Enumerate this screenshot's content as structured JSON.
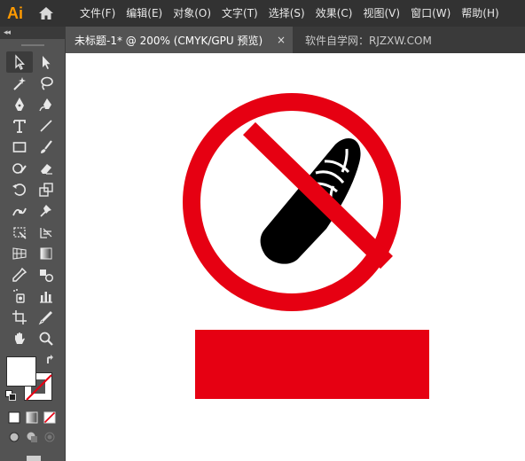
{
  "app": {
    "logo_text": "Ai"
  },
  "menu": {
    "items": [
      {
        "label": "文件(F)"
      },
      {
        "label": "编辑(E)"
      },
      {
        "label": "对象(O)"
      },
      {
        "label": "文字(T)"
      },
      {
        "label": "选择(S)"
      },
      {
        "label": "效果(C)"
      },
      {
        "label": "视图(V)"
      },
      {
        "label": "窗口(W)"
      },
      {
        "label": "帮助(H)"
      }
    ]
  },
  "tabs": [
    {
      "label": "未标题-1* @ 200% (CMYK/GPU 预览)",
      "close": "×",
      "active": true
    },
    {
      "label": "软件自学网：RJZXW.COM",
      "active": false
    }
  ],
  "toolbar": {
    "collapse_label": "◂◂",
    "tools": [
      [
        "selection-tool",
        "direct-selection-tool"
      ],
      [
        "magic-wand-tool",
        "lasso-tool"
      ],
      [
        "pen-tool",
        "curvature-tool"
      ],
      [
        "type-tool",
        "line-segment-tool"
      ],
      [
        "rectangle-tool",
        "paintbrush-tool"
      ],
      [
        "shaper-tool",
        "eraser-tool"
      ],
      [
        "rotate-tool",
        "scale-tool"
      ],
      [
        "puppet-warp-tool",
        "pin-tool"
      ],
      [
        "free-transform-tool",
        "shape-builder-tool"
      ],
      [
        "perspective-grid-tool",
        "gradient-tool"
      ],
      [
        "eyedropper-tool",
        "blend-tool"
      ],
      [
        "symbol-sprayer-tool",
        "column-graph-tool"
      ],
      [
        "artboard-tool",
        "slice-tool"
      ],
      [
        "hand-tool",
        "zoom-tool"
      ]
    ],
    "fill_color": "#ffffff",
    "stroke_color": "none"
  },
  "artwork": {
    "sign_color": "#e60012",
    "slipper_color": "#000000",
    "banner_color": "#e60012"
  }
}
